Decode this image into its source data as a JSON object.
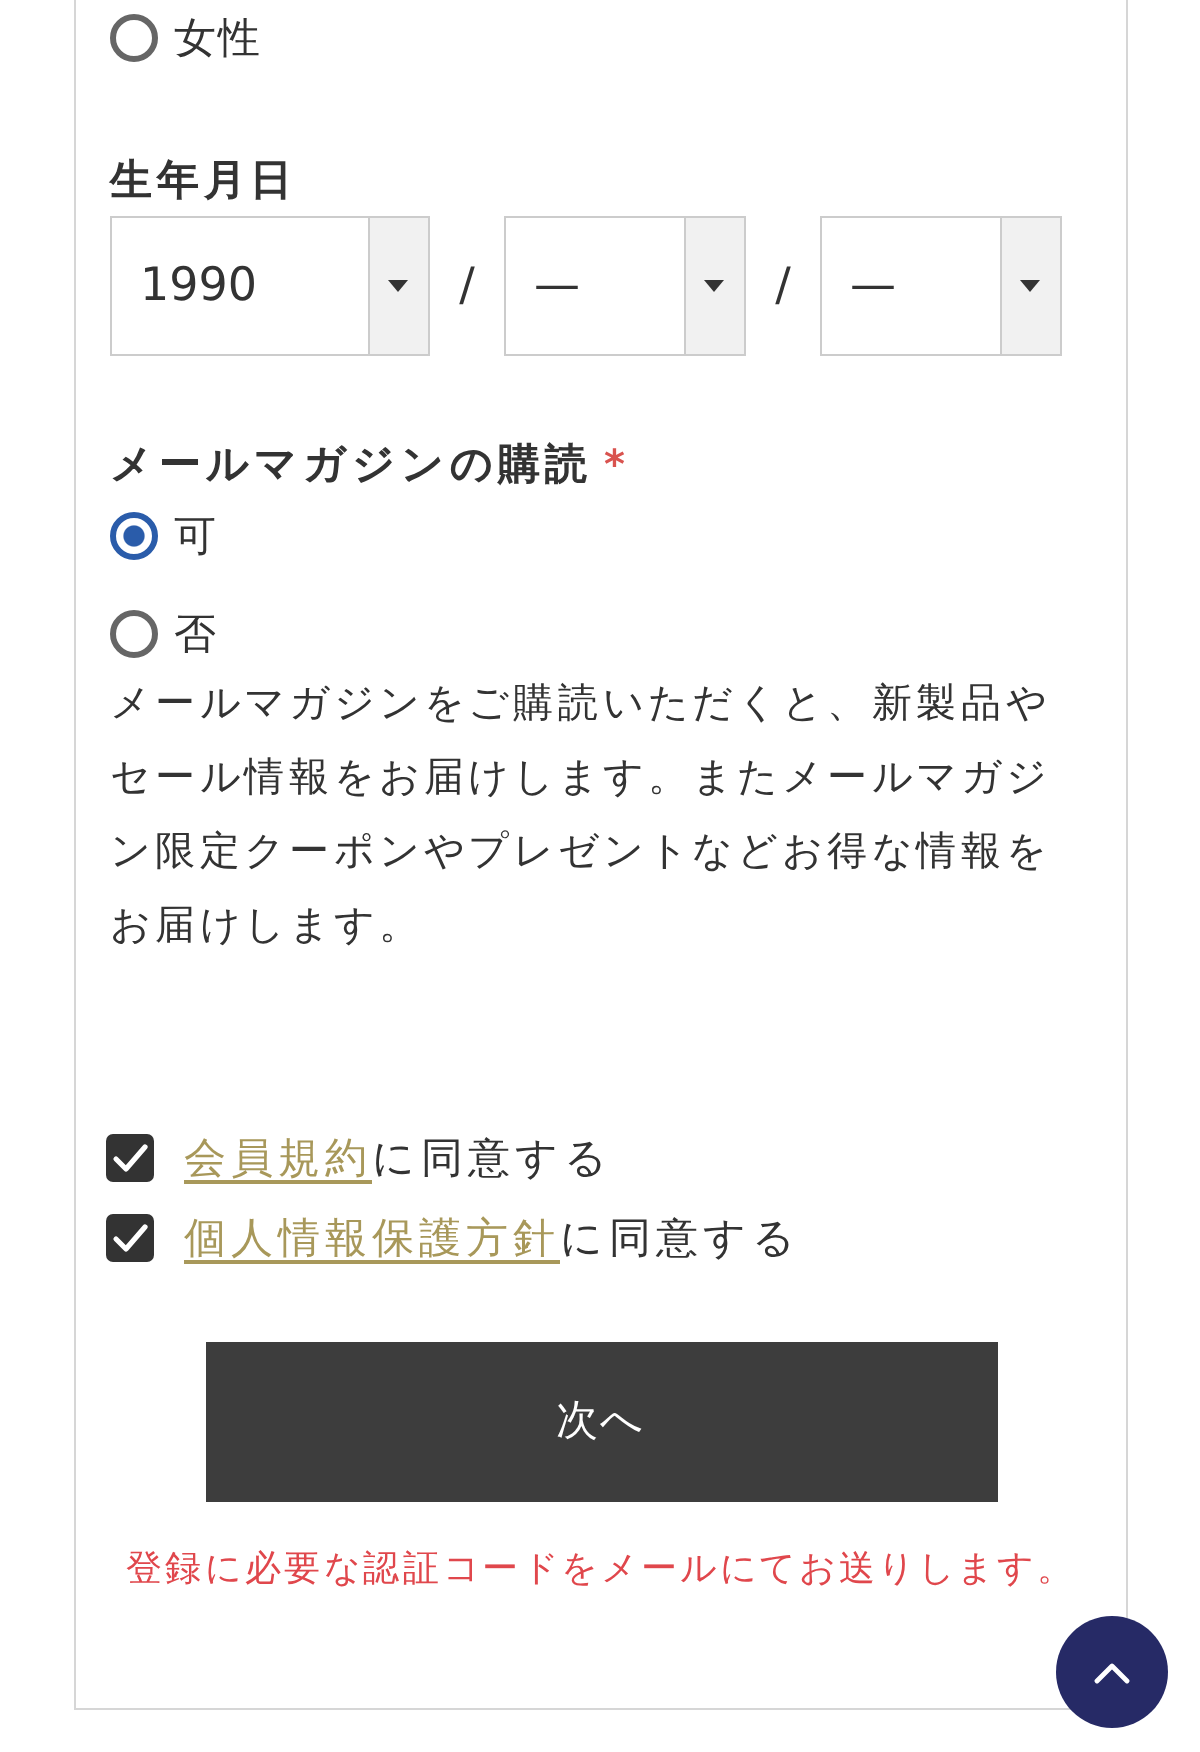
{
  "gender": {
    "options": [
      {
        "label": "女性",
        "selected": false
      }
    ]
  },
  "birthdate": {
    "label": "生年月日",
    "selects": [
      {
        "value": "1990"
      },
      {
        "value": "—"
      },
      {
        "value": "—"
      }
    ],
    "separator": "/"
  },
  "newsletter": {
    "label": "メールマガジンの購読",
    "required_mark": "*",
    "options": [
      {
        "label": "可",
        "selected": true
      },
      {
        "label": "否",
        "selected": false
      }
    ],
    "description": "メールマガジンをご購読いただくと、新製品やセール情報をお届けします。またメールマガジン限定クーポンやプレゼントなどお得な情報をお届けします。"
  },
  "agreements": [
    {
      "link": "会員規約",
      "text": "に同意する",
      "checked": true
    },
    {
      "link": "個人情報保護方針",
      "text": "に同意する",
      "checked": true
    }
  ],
  "next_button": "次へ",
  "note": "登録に必要な認証コードをメールにてお送りします。"
}
